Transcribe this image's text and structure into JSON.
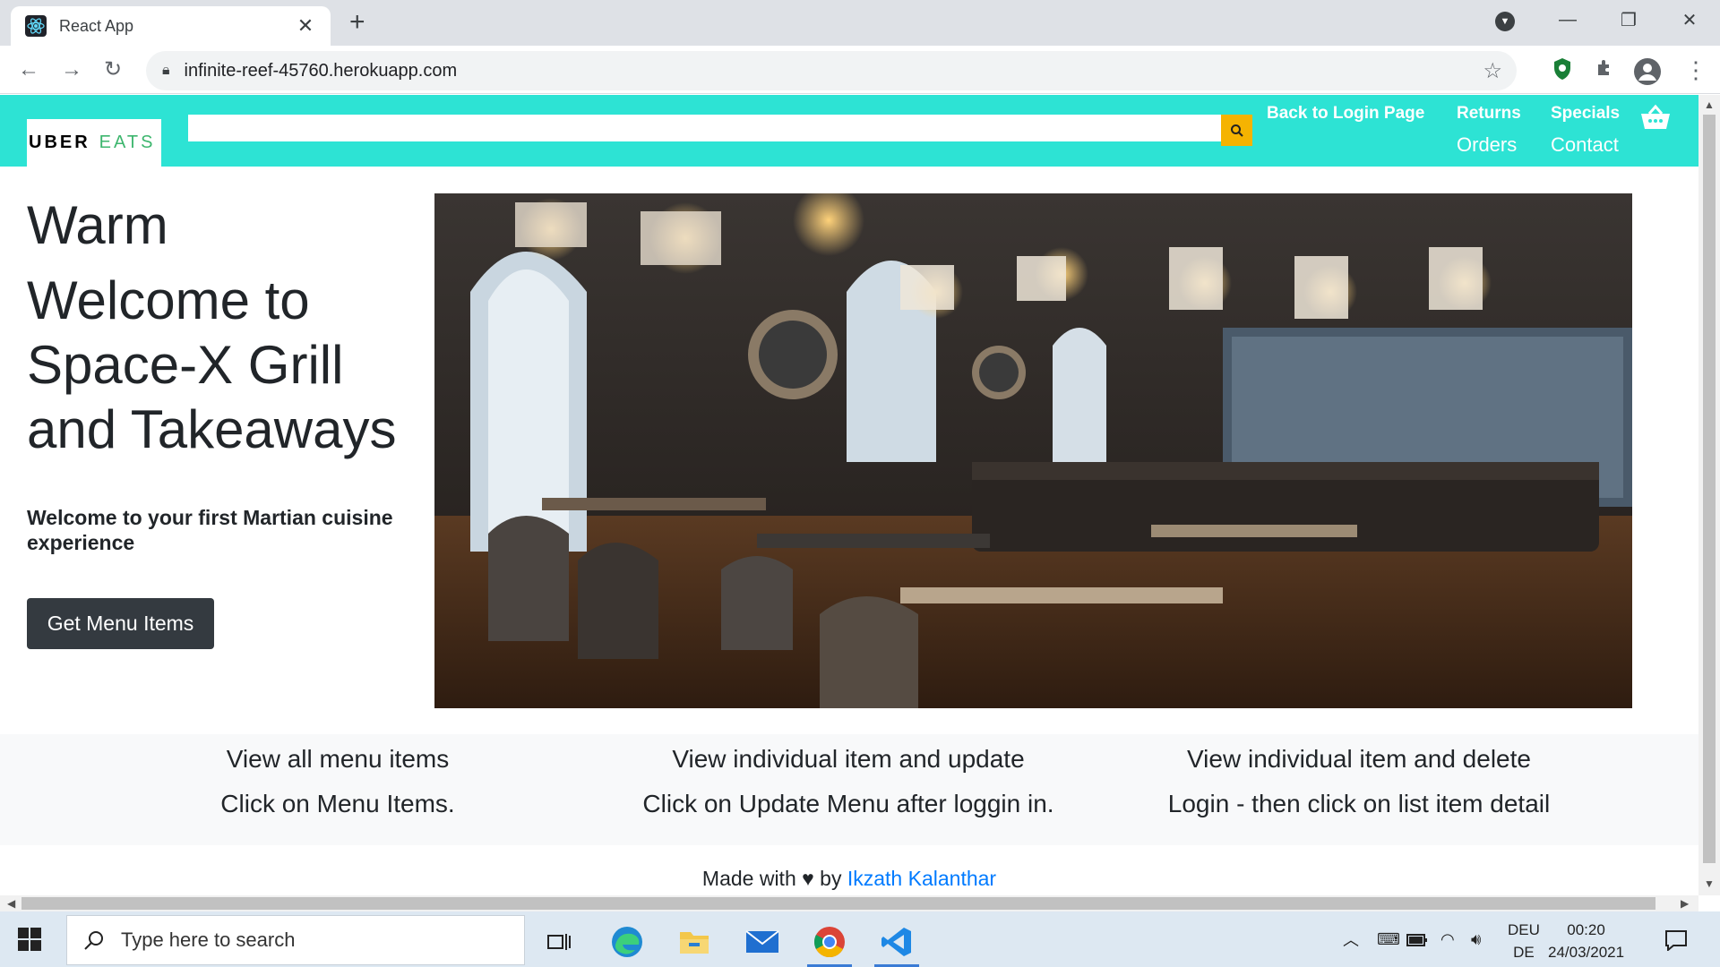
{
  "browser": {
    "tab_title": "React App",
    "tab_close": "✕",
    "new_tab": "+",
    "url": "infinite-reef-45760.herokuapp.com"
  },
  "navbar": {
    "logo_uber": "UBER",
    "logo_eats": "EATS",
    "search_value": "",
    "links": {
      "back_to_login": "Back to Login Page",
      "returns": "Returns",
      "specials": "Specials",
      "orders": "Orders",
      "contact": "Contact"
    }
  },
  "hero": {
    "line1": "Warm",
    "line2": "Welcome to",
    "line3": "Space-X Grill",
    "line4": "and Takeaways",
    "subtitle": "Welcome to your first Martian cuisine experience",
    "button": "Get Menu Items"
  },
  "features": [
    {
      "title": "View all menu items",
      "text": "Click on Menu Items."
    },
    {
      "title": "View individual item and update",
      "text": "Click on Update Menu after loggin in."
    },
    {
      "title": "View individual item and delete",
      "text": "Login - then click on list item detail"
    }
  ],
  "footer": {
    "made_with": "Made with",
    "heart": "♥",
    "by": "by",
    "author": "Ikzath Kalanthar"
  },
  "taskbar": {
    "search_placeholder": "Type here to search",
    "lang_top": "DEU",
    "lang_bottom": "DE",
    "time": "00:20",
    "date": "24/03/2021"
  },
  "colors": {
    "navbar": "#2de3d4",
    "search_button": "#f5b301",
    "dark_button": "#343a40",
    "link": "#007bff"
  }
}
